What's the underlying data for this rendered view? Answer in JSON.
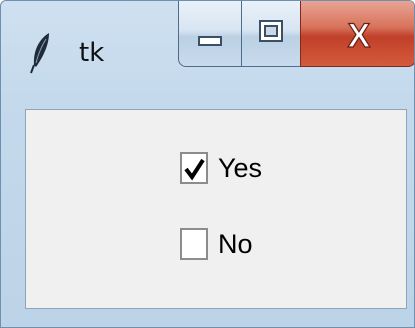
{
  "window": {
    "title": "tk",
    "app_icon": "feather-icon"
  },
  "controls": {
    "minimize_icon": "minimize-icon",
    "maximize_icon": "maximize-icon",
    "close_icon": "close-icon",
    "close_glyph": "X"
  },
  "checkboxes": [
    {
      "label": "Yes",
      "checked": true
    },
    {
      "label": "No",
      "checked": false
    }
  ]
}
